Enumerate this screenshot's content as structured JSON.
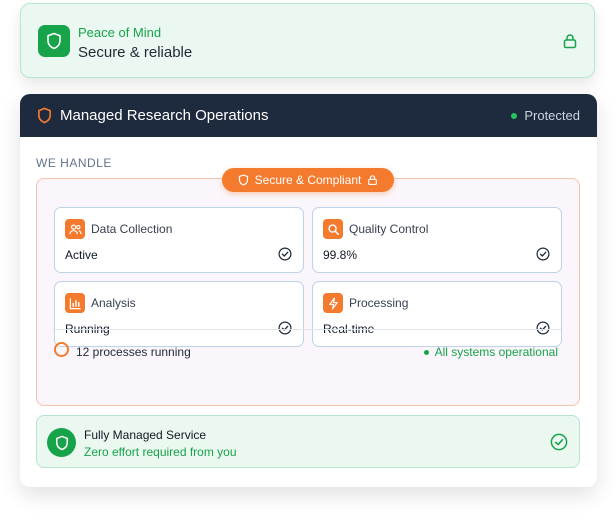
{
  "top_card": {
    "kicker": "Peace of Mind",
    "title": "Secure & reliable",
    "icon": "shield-icon",
    "trailing_icon": "lock-icon"
  },
  "header": {
    "title": "Managed Research Operations",
    "status": "Protected",
    "icon": "shield-icon"
  },
  "section_label": "WE HANDLE",
  "badge": {
    "label": "Secure & Compliant",
    "icons": [
      "shield-icon",
      "lock-icon"
    ]
  },
  "tiles": [
    {
      "title": "Data Collection",
      "value": "Active",
      "icon": "users-icon"
    },
    {
      "title": "Quality Control",
      "value": "99.8%",
      "icon": "search-icon"
    },
    {
      "title": "Analysis",
      "value": "Running",
      "icon": "bar-chart-icon"
    },
    {
      "title": "Processing",
      "value": "Real-time",
      "icon": "bolt-icon"
    }
  ],
  "footer": {
    "processes": "12 processes running",
    "operational": "All systems operational"
  },
  "service": {
    "title": "Fully Managed Service",
    "subtitle": "Zero effort required from you",
    "icon": "shield-icon",
    "trailing_icon": "check-circle-icon"
  },
  "colors": {
    "accent_orange": "#f47a2d",
    "success_green": "#16a34a",
    "header_navy": "#1e2a3d"
  }
}
